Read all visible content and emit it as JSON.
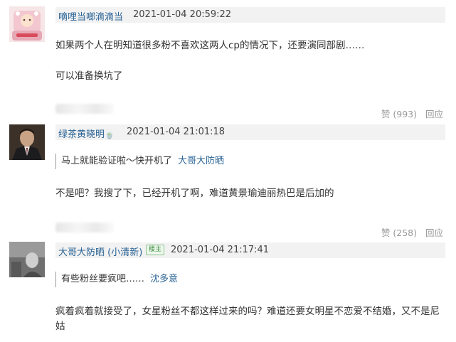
{
  "comments": [
    {
      "username": "嘀哩当啷滴滴当",
      "time": "2021-01-04 20:59:22",
      "paragraphs": [
        "如果两个人在明知道很多粉不喜欢这两人cp的情况下，还要演同部剧……",
        "可以准备换坑了"
      ],
      "like_label": "赞",
      "like_count": "(993)",
      "reply_label": "回应"
    },
    {
      "username": "绿茶黄晓明",
      "username_emoji": "🍵",
      "time": "2021-01-04 21:01:18",
      "quote_text": "马上就能验证啦～快开机了",
      "quote_user": "大哥大防晒",
      "text": "不是吧？我搜了下，已经开机了啊，难道黄景瑜迪丽热巴是后加的",
      "like_label": "赞",
      "like_count": "(258)",
      "reply_label": "回应"
    },
    {
      "username": "大哥大防晒",
      "username_suffix": "(小清新)",
      "badge": "楼主",
      "time": "2021-01-04 21:17:41",
      "quote_text": "有些粉丝要疯吧……",
      "quote_user": "沈多意",
      "text_lines": [
        "疯着疯着就接受了，女星粉丝不都这样过来的吗？难道还要女明星不恋爱不结婚，又不是尼",
        "姑"
      ]
    }
  ],
  "colors": {
    "link": "#2a6496",
    "header_bg": "#f2f2f2",
    "muted": "#999999",
    "text": "#333333"
  }
}
